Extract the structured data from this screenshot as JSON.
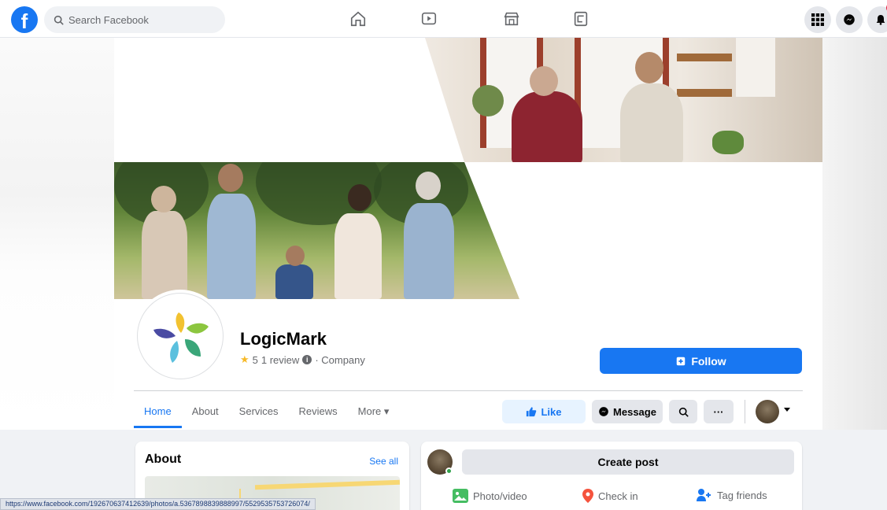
{
  "topbar": {
    "logo": "f",
    "search_placeholder": "Search Facebook",
    "nav": [
      "home-icon",
      "watch-icon",
      "marketplace-icon",
      "gaming-icon"
    ],
    "right": [
      "menu-grid-icon",
      "messenger-icon",
      "notifications-icon"
    ]
  },
  "profile": {
    "name": "LogicMark",
    "rating": "5",
    "review_text": "1 review",
    "category": "· Company",
    "follow_label": "Follow"
  },
  "tabs": [
    {
      "label": "Home",
      "active": true
    },
    {
      "label": "About"
    },
    {
      "label": "Services"
    },
    {
      "label": "Reviews"
    },
    {
      "label": "More ▾"
    }
  ],
  "actions": {
    "like": "Like",
    "message": "Message",
    "search": "search-icon",
    "more": "···"
  },
  "about_card": {
    "title": "About",
    "see_all": "See all"
  },
  "post_card": {
    "create_post": "Create post",
    "photo_video": "Photo/video",
    "check_in": "Check in",
    "tag_friends": "Tag friends"
  },
  "status_url": "https://www.facebook.com/192670637412639/photos/a.5367898839888997/5529535753726074/",
  "colors": {
    "brand": "#1877f2",
    "background": "#f0f2f5",
    "star": "#f7b928"
  }
}
